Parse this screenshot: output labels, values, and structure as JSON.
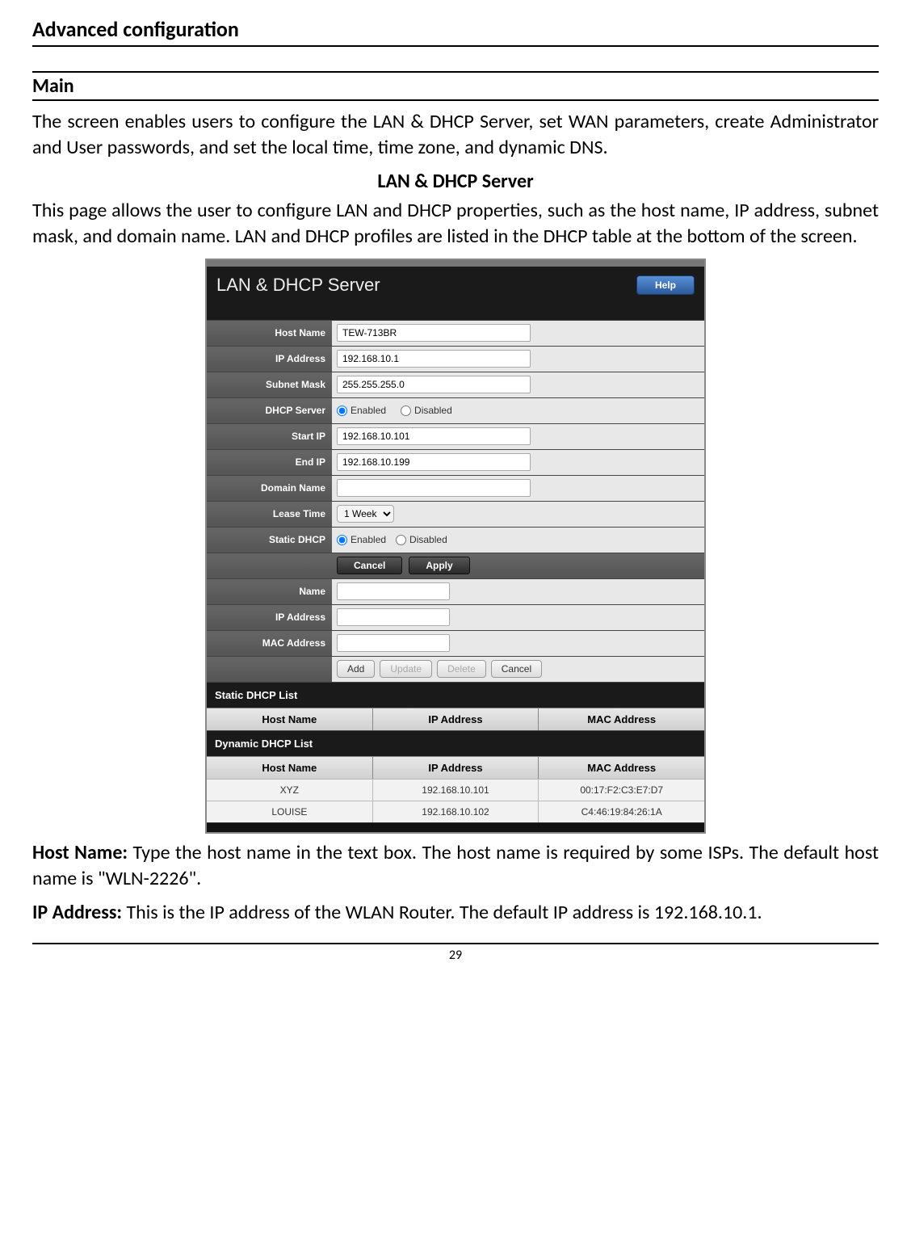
{
  "doc": {
    "header": "Advanced configuration",
    "section_main": "Main",
    "intro": "The screen enables users to configure the LAN & DHCP Server, set WAN parameters, create Administrator and User passwords, and set the local time, time zone, and dynamic DNS.",
    "sub_heading": "LAN & DHCP Server",
    "sub_intro": "This page allows the user to configure LAN and DHCP properties, such as the host name, IP address, subnet mask, and domain name. LAN and DHCP profiles are listed in the DHCP table at the bottom of the screen.",
    "host_name_label": "Host Name:",
    "host_name_desc": " Type the host name in the text box. The host name is required by some ISPs. The default host name is \"WLN-2226\".",
    "ip_label": "IP Address:",
    "ip_desc": " This is the IP address of the WLAN Router. The default IP address is 192.168.10.1.",
    "page_number": "29"
  },
  "ui": {
    "title": "LAN & DHCP Server",
    "help": "Help",
    "labels": {
      "host_name": "Host Name",
      "ip_address": "IP Address",
      "subnet_mask": "Subnet Mask",
      "dhcp_server": "DHCP Server",
      "start_ip": "Start IP",
      "end_ip": "End IP",
      "domain_name": "Domain Name",
      "lease_time": "Lease Time",
      "static_dhcp": "Static DHCP",
      "name": "Name",
      "ip_address2": "IP Address",
      "mac_address": "MAC Address"
    },
    "values": {
      "host_name": "TEW-713BR",
      "ip_address": "192.168.10.1",
      "subnet_mask": "255.255.255.0",
      "start_ip": "192.168.10.101",
      "end_ip": "192.168.10.199",
      "domain_name": "",
      "lease_time": "1 Week",
      "name": "",
      "ip2": "",
      "mac": ""
    },
    "radio": {
      "enabled": "Enabled",
      "disabled": "Disabled"
    },
    "buttons": {
      "cancel": "Cancel",
      "apply": "Apply",
      "add": "Add",
      "update": "Update",
      "delete": "Delete",
      "cancel2": "Cancel"
    },
    "static_list_title": "Static DHCP List",
    "dynamic_list_title": "Dynamic DHCP List",
    "columns": {
      "host_name": "Host Name",
      "ip_address": "IP Address",
      "mac_address": "MAC Address"
    },
    "dynamic_rows": [
      {
        "host": "XYZ",
        "ip": "192.168.10.101",
        "mac": "00:17:F2:C3:E7:D7"
      },
      {
        "host": "LOUISE",
        "ip": "192.168.10.102",
        "mac": "C4:46:19:84:26:1A"
      }
    ]
  }
}
